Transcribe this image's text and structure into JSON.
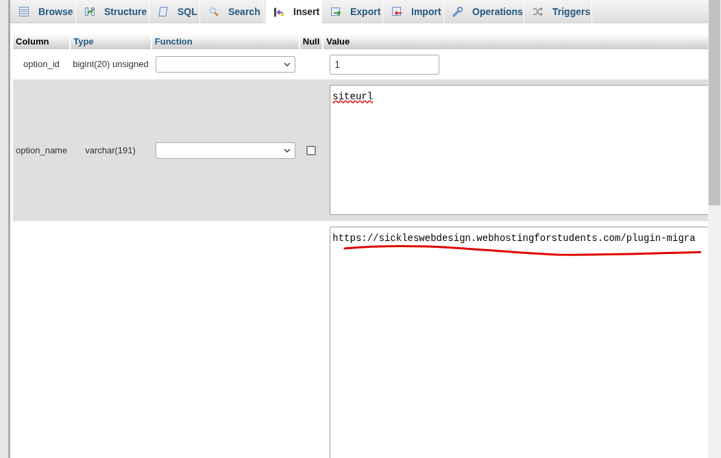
{
  "tabs": [
    {
      "label": "Browse",
      "selected": false
    },
    {
      "label": "Structure",
      "selected": false
    },
    {
      "label": "SQL",
      "selected": false
    },
    {
      "label": "Search",
      "selected": false
    },
    {
      "label": "Insert",
      "selected": true
    },
    {
      "label": "Export",
      "selected": false
    },
    {
      "label": "Import",
      "selected": false
    },
    {
      "label": "Operations",
      "selected": false
    },
    {
      "label": "Triggers",
      "selected": false
    }
  ],
  "table": {
    "columns": [
      "Column",
      "Type",
      "Function",
      "Null",
      "Value"
    ],
    "rows": [
      {
        "column": "option_id",
        "type": "bigint(20) unsigned",
        "kind": "input",
        "value": "1"
      },
      {
        "column": "option_name",
        "type": "varchar(191)",
        "kind": "textarea",
        "null_checked": false,
        "value": "siteurl",
        "spellcheck_error": true
      },
      {
        "kind": "textarea",
        "value": "https://sickleswebdesign.webhostingforstudents.com/plugin-migra",
        "annotated": true
      }
    ]
  }
}
